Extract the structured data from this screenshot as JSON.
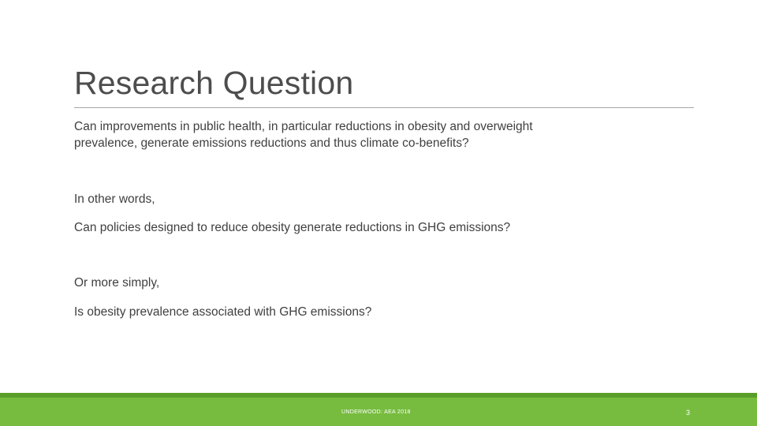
{
  "slide": {
    "title": "Research Question",
    "paragraphs": [
      "Can improvements in public health, in particular reductions in obesity and overweight",
      "prevalence, generate emissions reductions and thus climate co-benefits?",
      "In other words,",
      "Can policies designed to reduce obesity generate reductions in GHG emissions?",
      "Or more simply,",
      "Is obesity prevalence associated with GHG emissions?"
    ],
    "footer": {
      "text": "UNDERWOOD: AEA 2018",
      "page_number": "3"
    }
  },
  "colors": {
    "accent_green": "#77bc3f",
    "accent_green_dark": "#5a9e2a",
    "title_text": "#4d4d4d",
    "body_text": "#404040"
  }
}
